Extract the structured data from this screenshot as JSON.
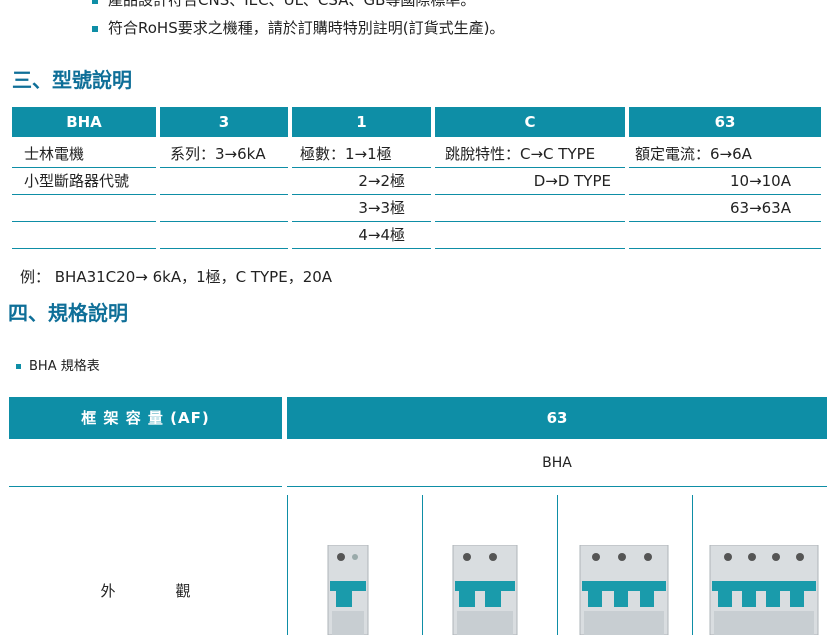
{
  "intro_lines": [
    "產品設計符合CNS、IEC、UL、CSA、GB等國際標準。",
    "符合RoHS要求之機種，請於訂購時特別註明(訂貨式生產)。"
  ],
  "section3": {
    "title": "三、型號說明",
    "headers": [
      "BHA",
      "3",
      "1",
      "C",
      "63"
    ],
    "rows": [
      [
        "士林電機",
        "系列：3→6kA",
        "極數：1→1極",
        "跳脫特性：C→C TYPE",
        "額定電流：6→6A"
      ],
      [
        "小型斷路器代號",
        "",
        "2→2極",
        "D→D TYPE",
        "10→10A"
      ],
      [
        "",
        "",
        "3→3極",
        "",
        "63→63A"
      ],
      [
        "",
        "",
        "4→4極",
        "",
        ""
      ]
    ],
    "example": "例： BHA31C20→ 6kA，1極，C TYPE，20A"
  },
  "section4": {
    "title": "四、規格說明",
    "table_label": "BHA 規格表",
    "frame_label": "框 架 容 量 (AF)",
    "frame_value": "63",
    "series": "BHA",
    "appearance_label": "外　　　　觀",
    "breaker_images": [
      "1-pole-breaker",
      "2-pole-breaker",
      "3-pole-breaker",
      "4-pole-breaker"
    ]
  },
  "colors": {
    "accent": "#0e8ea6",
    "title": "#0f6f98"
  }
}
